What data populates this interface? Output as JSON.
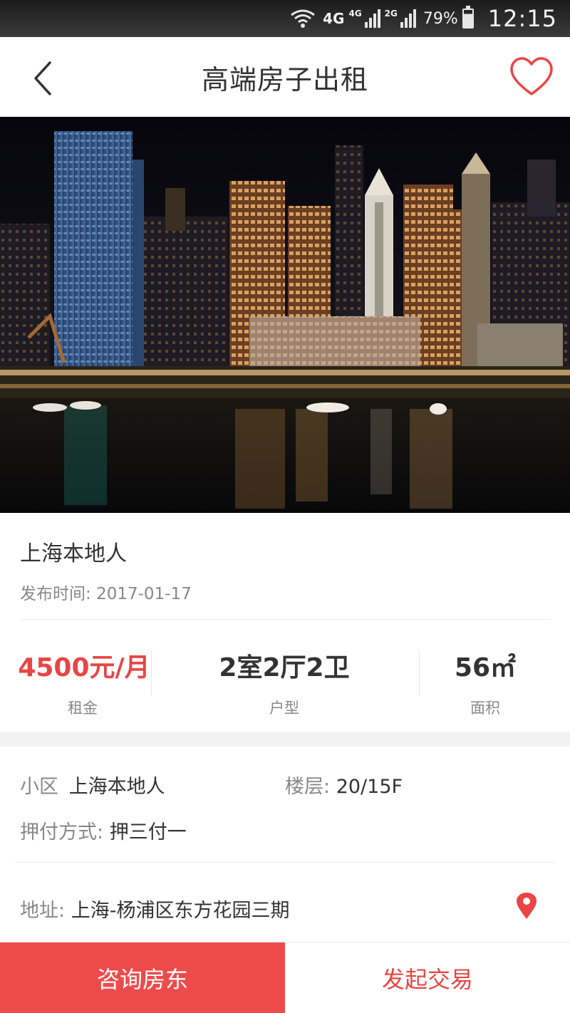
{
  "status_bar": {
    "network": "4G",
    "network_sim2": "4G",
    "network_sim3": "2G",
    "battery": "79%",
    "time": "12:15"
  },
  "header": {
    "title": "高端房子出租"
  },
  "listing": {
    "owner": "上海本地人",
    "publish_label": "发布时间:",
    "publish_date": "2017-01-17",
    "rent": {
      "value": "4500元/月",
      "label": "租金"
    },
    "layout": {
      "value": "2室2厅2卫",
      "label": "户型"
    },
    "area": {
      "value": "56㎡",
      "label": "面积"
    }
  },
  "details": {
    "community_label": "小区",
    "community_value": "上海本地人",
    "floor_label": "楼层:",
    "floor_value": "20/15F",
    "payment_label": "押付方式:",
    "payment_value": "押三付一",
    "address_label": "地址:",
    "address_value": "上海-杨浦区东方花园三期"
  },
  "actions": {
    "consult": "咨询房东",
    "deal": "发起交易"
  },
  "colors": {
    "accent": "#ed4b4b",
    "text_primary": "#333333",
    "text_secondary": "#888888"
  }
}
